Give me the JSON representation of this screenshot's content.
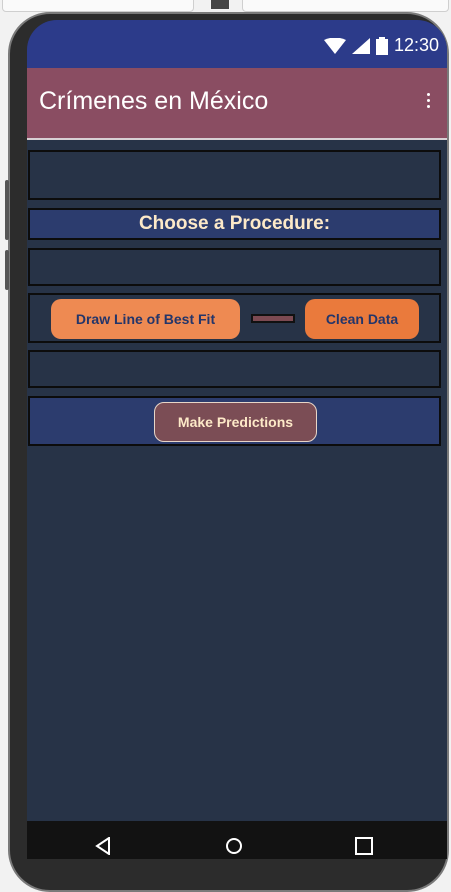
{
  "status_bar": {
    "time": "12:30",
    "icons": [
      "wifi-icon",
      "signal-icon",
      "battery-icon"
    ]
  },
  "app_bar": {
    "title": "Crímenes en México",
    "menu_icon": "more-vert-icon"
  },
  "main": {
    "heading": "Choose a Procedure:",
    "buttons": {
      "draw_line": "Draw Line of Best Fit",
      "clean_data": "Clean Data",
      "make_predictions": "Make Predictions"
    }
  },
  "nav_bar": {
    "icons": [
      "back-icon",
      "home-icon",
      "recents-icon"
    ]
  },
  "colors": {
    "status_bar": "#2c3b8a",
    "app_bar": "#8a4d62",
    "background": "#273347",
    "heading_text": "#fde9c8",
    "orange_button": "#ee8a52",
    "maroon_button": "#7b4d55"
  }
}
